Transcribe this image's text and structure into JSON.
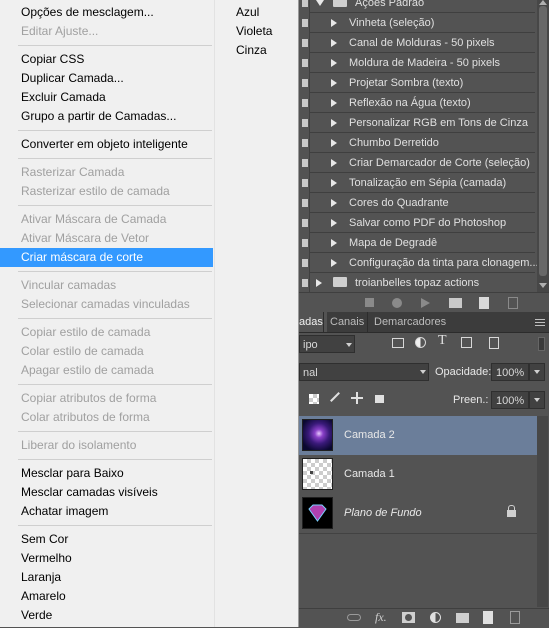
{
  "context_menu": {
    "groups": [
      [
        {
          "label": "Opções de mesclagem...",
          "disabled": false
        },
        {
          "label": "Editar Ajuste...",
          "disabled": true
        }
      ],
      [
        {
          "label": "Copiar CSS",
          "disabled": false
        },
        {
          "label": "Duplicar Camada...",
          "disabled": false
        },
        {
          "label": "Excluir Camada",
          "disabled": false
        },
        {
          "label": "Grupo a partir de Camadas...",
          "disabled": false
        }
      ],
      [
        {
          "label": "Converter em objeto inteligente",
          "disabled": false
        }
      ],
      [
        {
          "label": "Rasterizar Camada",
          "disabled": true
        },
        {
          "label": "Rasterizar estilo de camada",
          "disabled": true
        }
      ],
      [
        {
          "label": "Ativar Máscara de Camada",
          "disabled": true
        },
        {
          "label": "Ativar Máscara de Vetor",
          "disabled": true
        },
        {
          "label": "Criar máscara de corte",
          "disabled": false,
          "highlighted": true
        }
      ],
      [
        {
          "label": "Vincular camadas",
          "disabled": true
        },
        {
          "label": "Selecionar camadas vinculadas",
          "disabled": true
        }
      ],
      [
        {
          "label": "Copiar estilo de camada",
          "disabled": true
        },
        {
          "label": "Colar estilo de camada",
          "disabled": true
        },
        {
          "label": "Apagar estilo de camada",
          "disabled": true
        }
      ],
      [
        {
          "label": "Copiar atributos de forma",
          "disabled": true
        },
        {
          "label": "Colar atributos de forma",
          "disabled": true
        }
      ],
      [
        {
          "label": "Liberar do isolamento",
          "disabled": true
        }
      ],
      [
        {
          "label": "Mesclar para Baixo",
          "disabled": false
        },
        {
          "label": "Mesclar camadas visíveis",
          "disabled": false
        },
        {
          "label": "Achatar imagem",
          "disabled": false
        }
      ],
      [
        {
          "label": "Sem Cor",
          "disabled": false
        },
        {
          "label": "Vermelho",
          "disabled": false
        },
        {
          "label": "Laranja",
          "disabled": false
        },
        {
          "label": "Amarelo",
          "disabled": false
        },
        {
          "label": "Verde",
          "disabled": false
        }
      ]
    ],
    "extra_colors": [
      "Azul",
      "Violeta",
      "Cinza"
    ],
    "highlight_color": "#3399ff"
  },
  "actions_panel": {
    "set_name": "Ações Padrão",
    "items": [
      "Vinheta (seleção)",
      "Canal de Molduras - 50 pixels",
      "Moldura de Madeira - 50 pixels",
      "Projetar Sombra (texto)",
      "Reflexão na Água (texto)",
      "Personalizar RGB em Tons de Cinza",
      "Chumbo Derretido",
      "Criar Demarcador de Corte (seleção)",
      "Tonalização em Sépia (camada)",
      "Cores do Quadrante",
      "Salvar como PDF do Photoshop",
      "Mapa de Degradê",
      "Configuração da tinta para clonagem..."
    ],
    "closed_set": "troianbelles topaz actions",
    "toolbar_icons": [
      "stop-icon",
      "record-icon",
      "play-icon",
      "new-set-icon",
      "new-action-icon",
      "delete-icon"
    ]
  },
  "layers_panel": {
    "tabs": [
      "adas",
      "Canais",
      "Demarcadores"
    ],
    "active_tab_index": 0,
    "filter_value": "ipo",
    "blend_mode": "nal",
    "opacity_label": "Opacidade:",
    "opacity_value": "100%",
    "fill_label": "Preen.:",
    "fill_value": "100%",
    "layers": [
      {
        "name": "Camada 2",
        "selected": true,
        "thumb": "galaxy",
        "italic": false,
        "locked": false
      },
      {
        "name": "Camada 1",
        "selected": false,
        "thumb": "transparent",
        "italic": false,
        "locked": false
      },
      {
        "name": "Plano de Fundo",
        "selected": false,
        "thumb": "diamond",
        "italic": true,
        "locked": true
      }
    ],
    "bottom_icons": [
      "link-icon",
      "fx-icon",
      "mask-icon",
      "adjustment-icon",
      "group-icon",
      "new-layer-icon",
      "delete-icon"
    ]
  }
}
